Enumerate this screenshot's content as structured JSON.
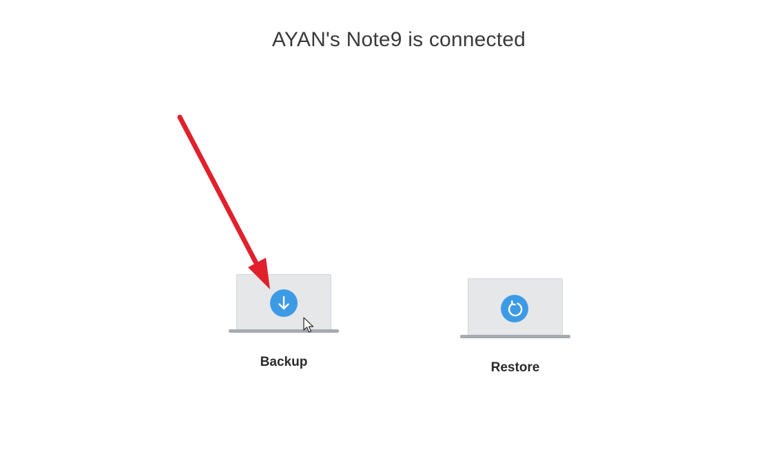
{
  "header": {
    "title": "AYAN's Note9 is connected"
  },
  "actions": [
    {
      "label": "Backup",
      "icon": "download-arrow-icon"
    },
    {
      "label": "Restore",
      "icon": "restore-circular-arrow-icon"
    }
  ],
  "colors": {
    "accent": "#3d9be6",
    "annotation_arrow": "#e0212b",
    "laptop_screen": "#e5e7e9",
    "laptop_base": "#a6abb0"
  }
}
